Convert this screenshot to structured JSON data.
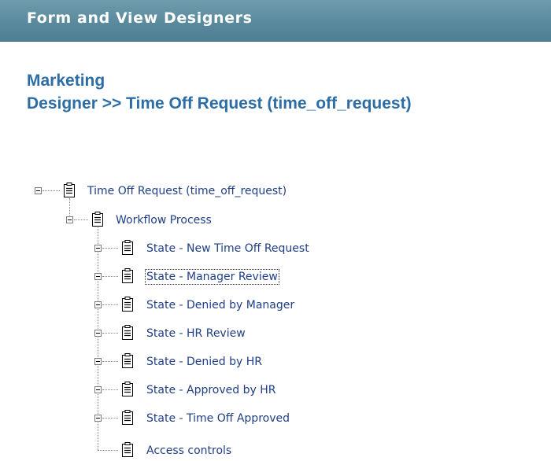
{
  "header": {
    "title": "Form and View Designers"
  },
  "breadcrumb": {
    "line1": "Marketing",
    "line2": "Designer >> Time Off Request (time_off_request)"
  },
  "tree": {
    "root": "Time Off Request (time_off_request)",
    "workflow": "Workflow Process",
    "states": [
      "State - New Time Off Request",
      "State - Manager Review",
      "State - Denied by Manager",
      "State - HR Review",
      "State - Denied by HR",
      "State - Approved by HR",
      "State - Time Off Approved"
    ],
    "access": "Access controls",
    "selected": "State - Manager Review"
  },
  "icons": {
    "expanded": "minus-box-icon",
    "collapsed": "plus-box-icon",
    "document": "document-icon"
  },
  "colors": {
    "header_bg": "#5a8a9d",
    "heading_text": "#2c6da5",
    "tree_text": "#1f3f86"
  }
}
